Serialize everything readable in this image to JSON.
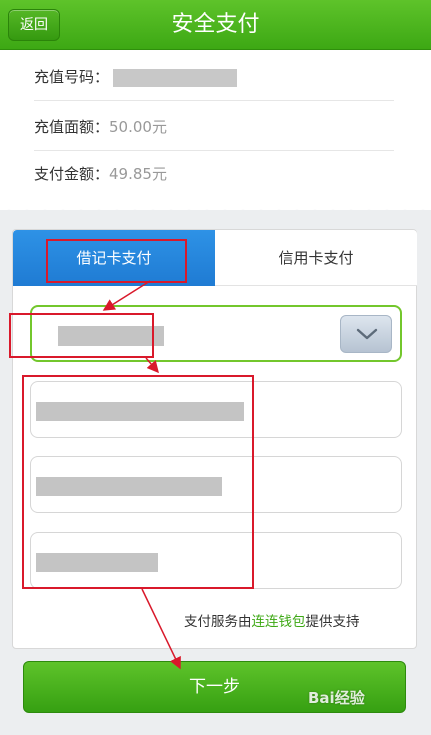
{
  "header": {
    "back_label": "返回",
    "title": "安全支付"
  },
  "info": {
    "phone_label": "充值号码：",
    "amount_label": "充值面额：",
    "amount_value": "50.00元",
    "pay_label": "支付金额：",
    "pay_value": "49.85元"
  },
  "tabs": {
    "debit": "借记卡支付",
    "credit": "信用卡支付"
  },
  "footer": {
    "prefix": "支付服务由",
    "brand": "连连钱包",
    "suffix": "提供支持"
  },
  "next_button": "下一步",
  "watermark": "Bai经验",
  "colors": {
    "brand_green": "#3da814",
    "tab_blue": "#1f7bd3",
    "annotation_red": "#d9192b"
  }
}
